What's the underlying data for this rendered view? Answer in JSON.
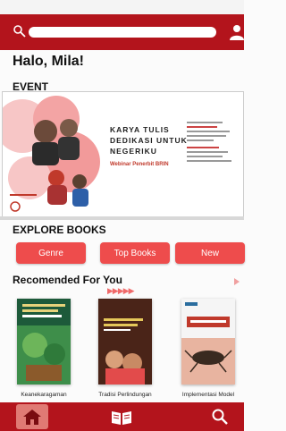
{
  "header": {
    "search_placeholder": ""
  },
  "greeting": "Halo, Mila!",
  "sections": {
    "event": "EVENT",
    "explore": "EXPLORE BOOKS",
    "recommended": "Recomended For You"
  },
  "event_banner": {
    "title_lines": [
      "KARYA TULIS",
      "DEDIKASI UNTUK",
      "NEGERIKU"
    ],
    "subtitle": "Webinar Penerbit BRIN"
  },
  "explore_buttons": [
    "Genre",
    "Top Books",
    "New"
  ],
  "books": [
    {
      "caption": "Keanekaragaman"
    },
    {
      "caption": "Tradisi Perlindungan"
    },
    {
      "caption": "Implementasi Model"
    }
  ],
  "colors": {
    "primary": "#b3141c",
    "chip": "#ee4c4c",
    "accent": "#f06a6a"
  },
  "nav": {
    "active": "home"
  }
}
